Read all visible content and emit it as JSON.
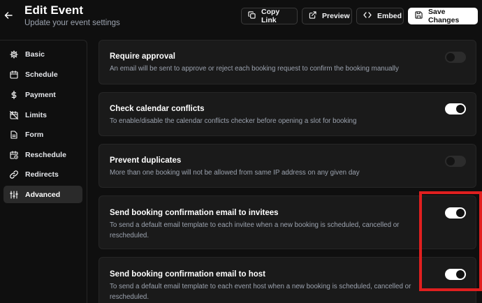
{
  "header": {
    "title": "Edit Event",
    "subtitle": "Update your event settings",
    "buttons": {
      "copy_link": "Copy Link",
      "preview": "Preview",
      "embed": "Embed",
      "save": "Save Changes"
    }
  },
  "sidebar": {
    "items": [
      {
        "label": "Basic",
        "icon": "gear-icon"
      },
      {
        "label": "Schedule",
        "icon": "calendar-icon"
      },
      {
        "label": "Payment",
        "icon": "dollar-icon"
      },
      {
        "label": "Limits",
        "icon": "calendar-off-icon"
      },
      {
        "label": "Form",
        "icon": "document-icon"
      },
      {
        "label": "Reschedule",
        "icon": "calendar-clock-icon"
      },
      {
        "label": "Redirects",
        "icon": "link-icon"
      },
      {
        "label": "Advanced",
        "icon": "sliders-icon",
        "active": true
      }
    ]
  },
  "settings": [
    {
      "title": "Require approval",
      "description": "An email will be sent to approve or reject each booking request to confirm the booking manually",
      "enabled": false
    },
    {
      "title": "Check calendar conflicts",
      "description": "To enable/disable the calendar conflicts checker before opening a slot for booking",
      "enabled": true
    },
    {
      "title": "Prevent duplicates",
      "description": "More than one booking will not be allowed from same IP address on any given day",
      "enabled": false
    },
    {
      "title": "Send booking confirmation email to invitees",
      "description": "To send a default email template to each invitee when a new booking is scheduled, cancelled or rescheduled.",
      "enabled": true
    },
    {
      "title": "Send booking confirmation email to host",
      "description": "To send a default email template to each event host when a new booking is scheduled, cancelled or rescheduled.",
      "enabled": true
    }
  ],
  "colors": {
    "background": "#0f0f0f",
    "card": "#1a1a1a",
    "highlight": "#e01f1f",
    "muted_text": "#9ca3af"
  }
}
